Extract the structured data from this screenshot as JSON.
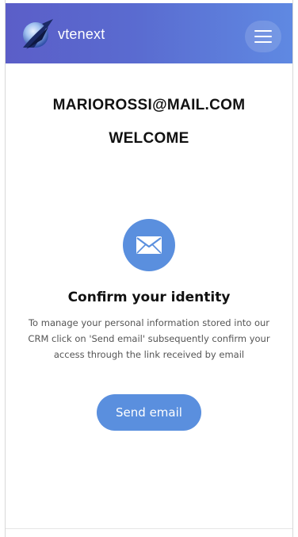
{
  "header": {
    "brand_name": "vtenext",
    "logo_icon": "vtenext-logo-icon",
    "menu_icon": "hamburger-menu-icon",
    "gradient_start": "#5b5ec8",
    "gradient_end": "#5f89e2"
  },
  "main": {
    "email": "MARIOROSSI@MAIL.COM",
    "welcome": "WELCOME",
    "mail_icon": "envelope-icon",
    "confirm_title": "Confirm your identity",
    "description": "To manage your personal information stored into our CRM click on 'Send email' subsequently confirm your access through the link received by email",
    "send_button_label": "Send email",
    "accent_color": "#5a8fde"
  }
}
